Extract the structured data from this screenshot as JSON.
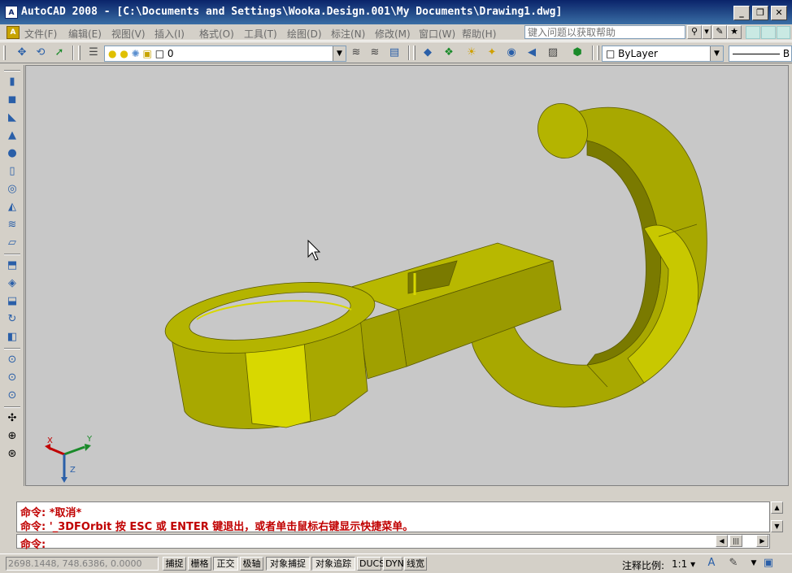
{
  "window": {
    "title": "AutoCAD 2008 - [C:\\Documents and Settings\\Wooka.Design.001\\My Documents\\Drawing1.dwg]",
    "app_icon_text": "A",
    "minimize_glyph": "_",
    "restore_glyph": "❐",
    "close_glyph": "✕"
  },
  "menu": {
    "items": [
      "文件(F)",
      "编辑(E)",
      "视图(V)",
      "插入(I)",
      "格式(O)",
      "工具(T)",
      "绘图(D)",
      "标注(N)",
      "修改(M)",
      "窗口(W)",
      "帮助(H)"
    ],
    "help_placeholder": "键入问题以获取帮助",
    "search_glyph": "⚲",
    "dropdown_glyph": "▾",
    "favorites_glyph": "★"
  },
  "toolbar": {
    "layer_value": "0",
    "color_value": "ByLayer",
    "linetype_prefix": "B"
  },
  "command": {
    "history": [
      "命令: *取消*",
      "命令: '_3DFOrbit 按 ESC 或 ENTER 键退出，或者单击鼠标右键显示快捷菜单。"
    ],
    "prompt": "命令:"
  },
  "status": {
    "coordinates": "2698.1448, 748.6386, 0.0000",
    "toggles": [
      {
        "label": "捕捉",
        "on": false
      },
      {
        "label": "栅格",
        "on": false
      },
      {
        "label": "正交",
        "on": true
      },
      {
        "label": "极轴",
        "on": false
      },
      {
        "label": "对象捕捉",
        "on": true
      },
      {
        "label": "对象追踪",
        "on": true
      },
      {
        "label": "DUCS",
        "on": false
      },
      {
        "label": "DYN",
        "on": false
      },
      {
        "label": "线宽",
        "on": false
      }
    ],
    "annotation_scale_label": "注释比例:",
    "annotation_scale_value": "1:1 ▾"
  },
  "ucs": {
    "x_label": "X",
    "y_label": "Y",
    "z_label": "Z"
  },
  "colors": {
    "model_face": "#a8a800",
    "model_light": "#d8d800",
    "model_dark": "#7a7a00",
    "viewport_bg": "#c8c8c8",
    "command_text": "#c00000"
  }
}
